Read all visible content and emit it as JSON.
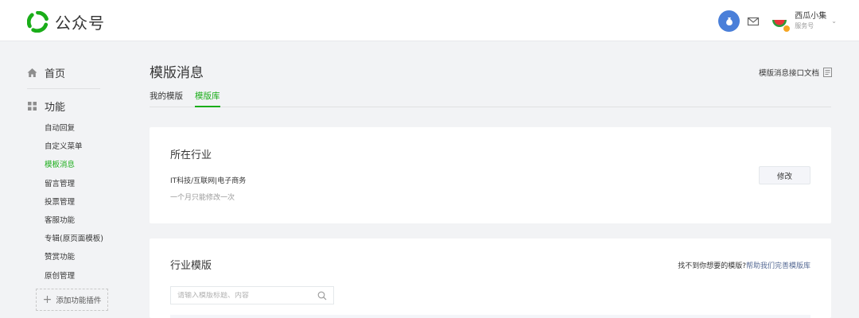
{
  "header": {
    "logo_text": "公众号",
    "account_name": "西瓜小集",
    "account_type": "服务号",
    "caret": "⌄"
  },
  "sidebar": {
    "home_label": "首页",
    "func_label": "功能",
    "items": [
      {
        "label": "自动回复"
      },
      {
        "label": "自定义菜单"
      },
      {
        "label": "模板消息"
      },
      {
        "label": "留言管理"
      },
      {
        "label": "投票管理"
      },
      {
        "label": "客服功能"
      },
      {
        "label": "专辑(原页面模板)"
      },
      {
        "label": "赞赏功能"
      },
      {
        "label": "原创管理"
      }
    ],
    "add_plugin_label": "添加功能插件"
  },
  "main": {
    "title": "模版消息",
    "doc_link": "模版消息接口文档",
    "tabs": [
      {
        "label": "我的模版"
      },
      {
        "label": "模版库"
      }
    ]
  },
  "industry_card": {
    "title": "所在行业",
    "industry": "IT科技/互联网|电子商务",
    "hint": "一个月只能修改一次",
    "edit_label": "修改"
  },
  "template_card": {
    "title": "行业模版",
    "help_text": "找不到你想要的模版?",
    "help_link": "帮助我们完善模版库",
    "search_placeholder": "请输入模版标题、内容"
  },
  "colors": {
    "accent": "#1aad19",
    "link": "#576b95",
    "coin": "#4a7fd9"
  }
}
